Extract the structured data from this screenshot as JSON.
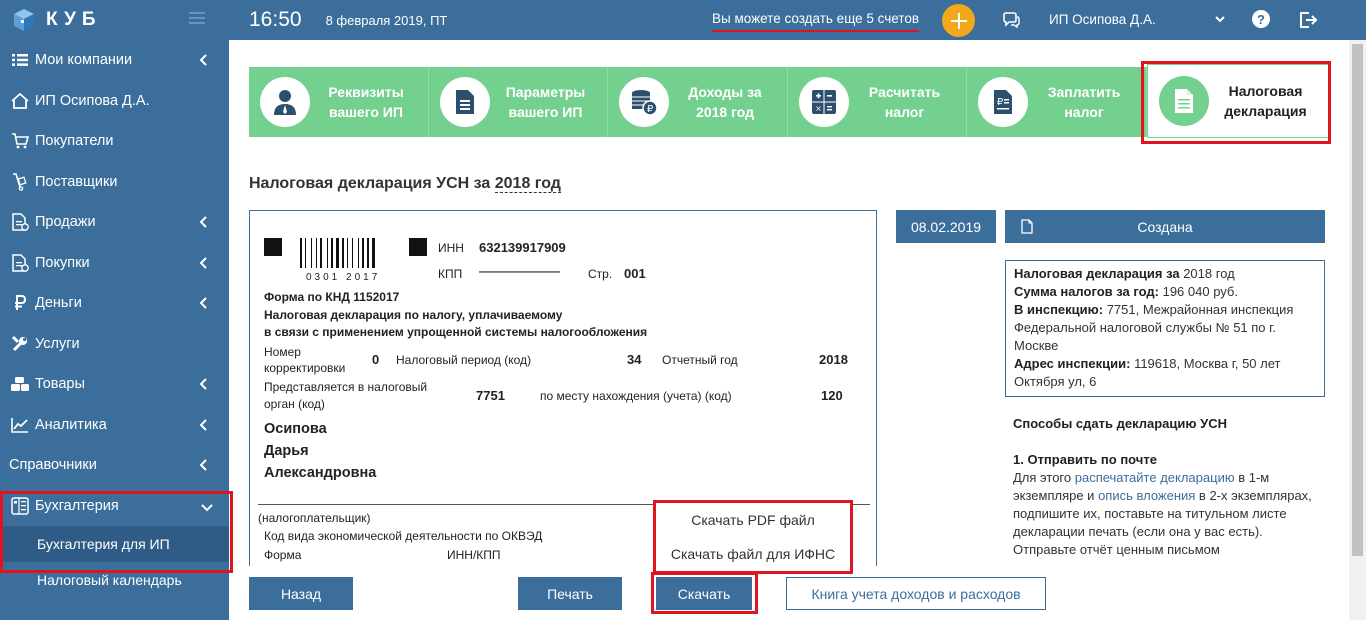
{
  "sidebar": {
    "logo_text": "КУБ",
    "items": [
      {
        "label": "Мои компании",
        "icon": "list-icon",
        "chevron": "left"
      },
      {
        "label": "ИП Осипова Д.А.",
        "icon": "home-icon",
        "chevron": ""
      },
      {
        "label": "Покупатели",
        "icon": "cart-icon",
        "chevron": ""
      },
      {
        "label": "Поставщики",
        "icon": "dolly-icon",
        "chevron": ""
      },
      {
        "label": "Продажи",
        "icon": "document-icon",
        "chevron": "left"
      },
      {
        "label": "Покупки",
        "icon": "document-icon",
        "chevron": "left"
      },
      {
        "label": "Деньги",
        "icon": "ruble-icon",
        "chevron": "left"
      },
      {
        "label": "Услуги",
        "icon": "wrench-icon",
        "chevron": ""
      },
      {
        "label": "Товары",
        "icon": "boxes-icon",
        "chevron": "left"
      },
      {
        "label": "Аналитика",
        "icon": "chart-icon",
        "chevron": "left"
      },
      {
        "label": "Справочники",
        "icon": "",
        "chevron": "left"
      },
      {
        "label": "Бухгалтерия",
        "icon": "ledger-icon",
        "chevron": "down"
      }
    ],
    "subitems": [
      {
        "label": "Бухгалтерия для ИП",
        "current": true
      },
      {
        "label": "Налоговый календарь",
        "current": false
      }
    ]
  },
  "topbar": {
    "time": "16:50",
    "date": "8 февраля 2019, ПТ",
    "promo": "Вы можете создать еще 5 счетов",
    "user": "ИП Осипова Д.А.",
    "help": "?"
  },
  "steps": [
    {
      "label_1": "Реквизиты",
      "label_2": "вашего ИП",
      "icon": "person-icon"
    },
    {
      "label_1": "Параметры",
      "label_2": "вашего ИП",
      "icon": "document-icon"
    },
    {
      "label_1": "Доходы за",
      "label_2": "2018 год",
      "icon": "coins-icon"
    },
    {
      "label_1": "Расчитать",
      "label_2": "налог",
      "icon": "calculator-icon"
    },
    {
      "label_1": "Заплатить",
      "label_2": "налог",
      "icon": "payment-doc-icon"
    },
    {
      "label_1": "Налоговая",
      "label_2": "декларация",
      "icon": "declaration-icon",
      "active": true
    }
  ],
  "page_title": {
    "prefix": "Налоговая декларация УСН за ",
    "year": "2018 год"
  },
  "doc": {
    "barcode_number": "0301 2017",
    "inn_label": "ИНН",
    "inn": "632139917909",
    "kpp_label": "КПП",
    "kpp": "————————",
    "page_label": "Стр.",
    "page": "001",
    "form_knd": "Форма по КНД 1152017",
    "decl_title_1": "Налоговая декларация по налогу, уплачиваемому",
    "decl_title_2": "в связи с применением упрощенной системы налогообложения",
    "corr_label_1": "Номер",
    "corr_label_2": "корректировки",
    "corr": "0",
    "period_label": "Налоговый период (код)",
    "period": "34",
    "year_label": "Отчетный год",
    "year": "2018",
    "organ_label_1": "Представляется в налоговый",
    "organ_label_2": "орган (код)",
    "organ": "7751",
    "place_label": "по месту нахождения (учета) (код)",
    "place": "120",
    "name_1": "Осипова",
    "name_2": "Дарья",
    "name_3": "Александровна",
    "payer_label": "(налогоплательщик)",
    "okved_label": "Код вида экономической деятельности по ОКВЭД",
    "forma_label": "Форма",
    "innkpp_label": "ИНН/КПП"
  },
  "dropdown": [
    "Скачать PDF файл",
    "Скачать файл для ИФНС"
  ],
  "right": {
    "date": "08.02.2019",
    "status": "Создана",
    "info": [
      {
        "b": "Налоговая декларация за",
        "t": " 2018 год"
      },
      {
        "b": "Сумма налогов за год:",
        "t": " 196 040 руб."
      },
      {
        "b": "В инспекцию:",
        "t": " 7751, Межрайонная инспекция Федеральной налоговой службы № 51 по г. Москве"
      },
      {
        "b": "Адрес инспекции:",
        "t": " 119618, Москва г, 50 лет Октября ул, 6"
      }
    ],
    "methods_title": "Способы сдать декларацию УСН",
    "method1_title": "1. Отправить по почте",
    "m1_a": "Для этого ",
    "m1_link1": "распечатайте декларацию",
    "m1_b": " в 1-м экземпляре и ",
    "m1_link2": "опись вложения",
    "m1_c": " в 2-х экземплярах, подпишите их, поставьте на титульном листе декларации печать (если она у вас есть). Отправьте отчёт ценным письмом"
  },
  "buttons": {
    "back": "Назад",
    "print": "Печать",
    "download": "Скачать",
    "book": "Книга учета доходов и расходов"
  },
  "colors": {
    "primary": "#3c6e9b",
    "step_green": "#74d08f",
    "accent_orange": "#f3a81c",
    "highlight_red": "#e0141e"
  }
}
